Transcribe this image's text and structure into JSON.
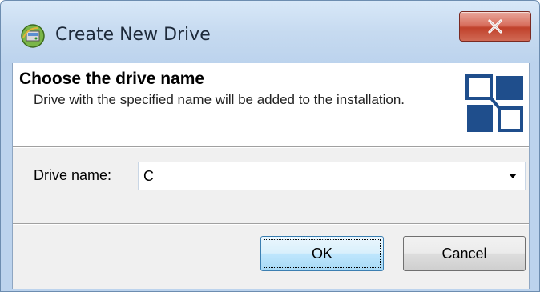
{
  "window": {
    "title": "Create New Drive",
    "icon": "drive-wizard-icon",
    "close_icon": "close-icon"
  },
  "header": {
    "title": "Choose the drive name",
    "description": "Drive with the specified name will be added to the installation.",
    "logo": "drive-logo-icon"
  },
  "form": {
    "drive_name_label": "Drive name:",
    "drive_name_value": "C",
    "dropdown_icon": "chevron-down-icon"
  },
  "buttons": {
    "ok_label": "OK",
    "cancel_label": "Cancel"
  },
  "colors": {
    "accent_blue": "#1f4e8c",
    "close_red": "#c0412b",
    "frame_blue": "#c6daf0"
  }
}
